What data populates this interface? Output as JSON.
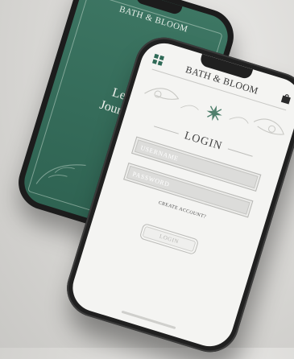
{
  "splash_screen": {
    "brand": "BATH & BLOOM",
    "headline_line1": "Let Ou",
    "headline_line2": "Journey B"
  },
  "login_screen": {
    "brand": "BATH & BLOOM",
    "menu_icon": "grid-icon",
    "bag_icon": "shopping-bag-icon",
    "title": "LOGIN",
    "username_placeholder": "USERNAME",
    "password_placeholder": "PASSWORD",
    "create_account": "CREATE ACCOUNT?",
    "login_button": "LOGIN"
  },
  "colors": {
    "brand_green": "#356c5a",
    "screen_bg": "#f4f4f2",
    "field_bg": "#dcdcda"
  }
}
